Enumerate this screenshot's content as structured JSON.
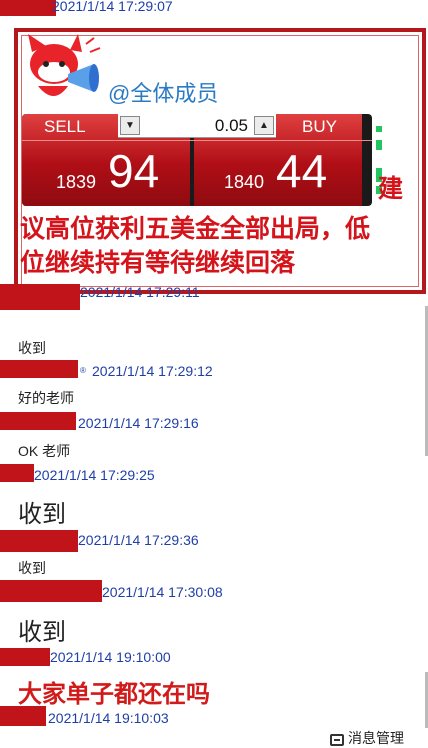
{
  "messages_top": {
    "ts0": "2021/1/14 17:29:07"
  },
  "announcement": {
    "mention": "@全体成员",
    "trade": {
      "sell_label": "SELL",
      "buy_label": "BUY",
      "lot": "0.05",
      "sell_price_small": "1839",
      "sell_price_large": "94",
      "buy_price_small": "1840",
      "buy_price_large": "44"
    },
    "text_line1": "建",
    "text_line2": "议高位获利五美金全部出局，低",
    "text_line3": "位继续持有等待继续回落"
  },
  "chat": [
    {
      "ts": "2021/1/14 17:29:11"
    },
    {
      "text": "收到",
      "ts": "2021/1/14 17:29:12"
    },
    {
      "text": "好的老师",
      "ts": "2021/1/14 17:29:16"
    },
    {
      "text": "OK  老师",
      "ts": "2021/1/14 17:29:25"
    },
    {
      "text": "收到",
      "ts": "2021/1/14 17:29:36"
    },
    {
      "text": "收到",
      "ts": "2021/1/14 17:30:08"
    },
    {
      "text": "收到",
      "ts": "2021/1/14 19:10:00"
    },
    {
      "text": "大家单子都还在吗",
      "ts": "2021/1/14 19:10:03"
    }
  ],
  "footer": {
    "manage_label": "消息管理"
  },
  "colors": {
    "accent_red": "#c0141a",
    "timestamp_blue": "#1f3fa8",
    "mention_blue": "#2b7bc4"
  }
}
